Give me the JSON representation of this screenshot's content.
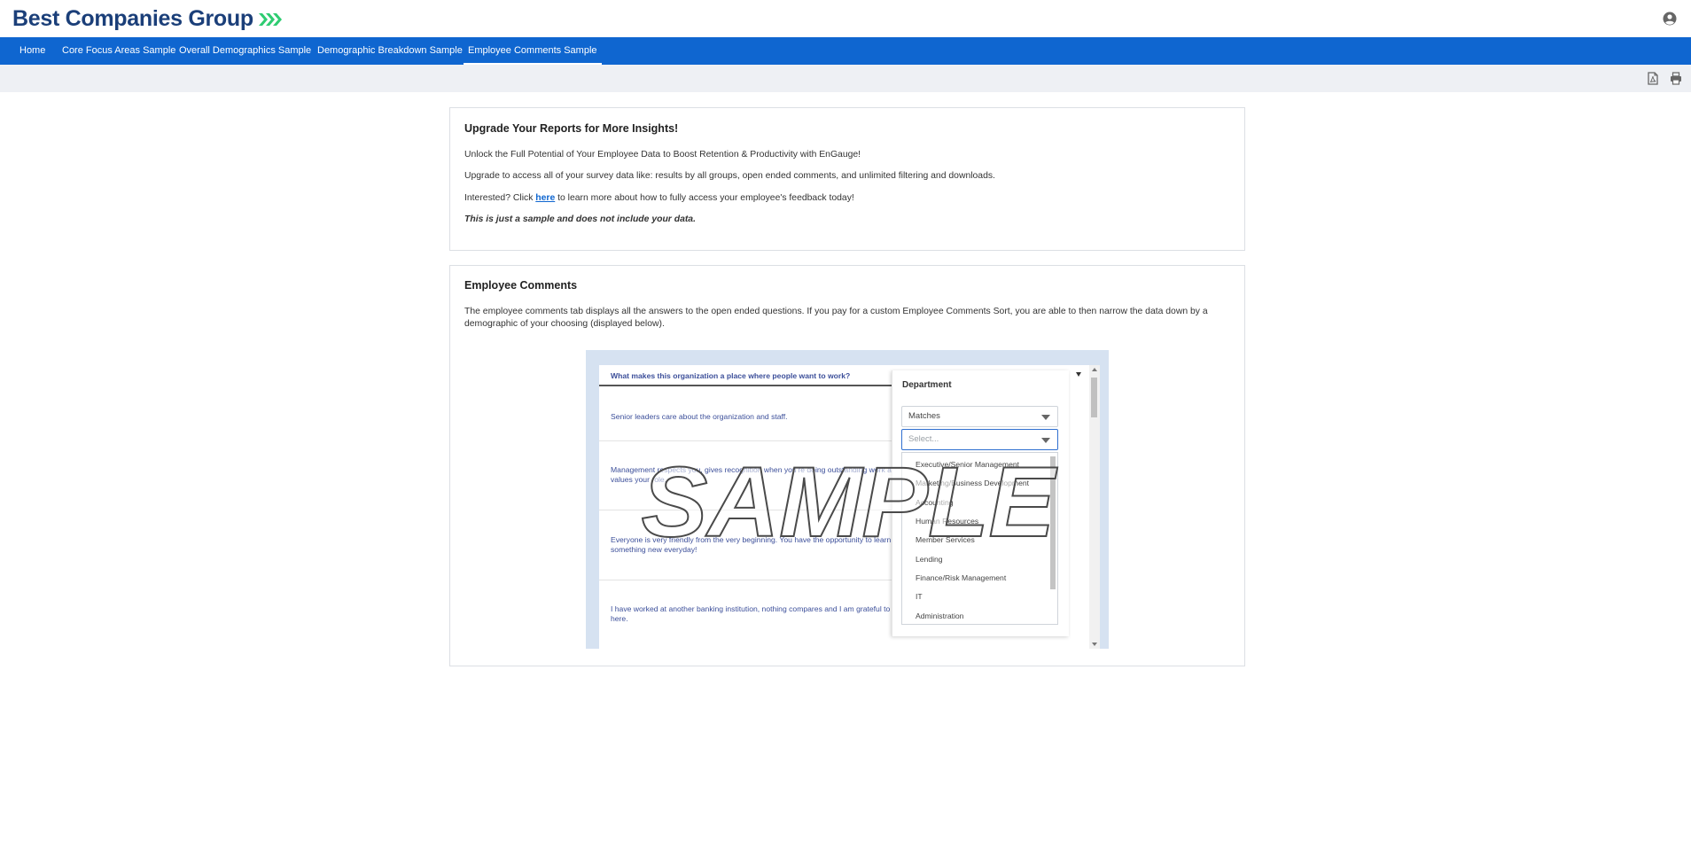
{
  "header": {
    "logo_text": "Best Companies Group",
    "brand_color": "#1b3f79",
    "accent_color": "#2ecc71",
    "user_icon": "user-circle-icon"
  },
  "nav": {
    "color": "#0f66d0",
    "items": [
      {
        "label": "Home"
      },
      {
        "label": "Core Focus Areas Sample"
      },
      {
        "label": "Overall Demographics Sample"
      },
      {
        "label": "Demographic Breakdown Sample"
      },
      {
        "label": "Employee Comments Sample",
        "active": true
      }
    ]
  },
  "toolbar": {
    "pdf_icon": "pdf-export-icon",
    "print_icon": "print-icon"
  },
  "upgrade": {
    "title": "Upgrade Your Reports for More Insights!",
    "line1": "Unlock the Full Potential of Your Employee Data to Boost Retention & Productivity with EnGauge!",
    "line2": "Upgrade to access all of your survey data like: results by all groups, open ended comments, and unlimited filtering and downloads.",
    "line3_before": "Interested? Click ",
    "line3_link": "here",
    "line3_after": " to learn more about how to fully access your employee's feedback today!",
    "line4": "This is just a sample and does not include your data."
  },
  "comments": {
    "title": "Employee Comments",
    "description": "The employee comments tab displays all the answers to the open ended questions. If you pay for a custom Employee Comments Sort, you are able to then narrow the data down by a demographic of your choosing (displayed below)."
  },
  "sample_image": {
    "question_header": "What makes this organization a place where people want to work?",
    "rows": [
      {
        "text": "Senior leaders care about the organization and staff."
      },
      {
        "text": "Management respects you, gives recognition when you're doing outstanding work and values your role."
      },
      {
        "text": "Everyone is very friendly from the very beginning. You have the opportunity to learn something new everyday!"
      },
      {
        "text": "I have worked at another banking institution, nothing compares and I am grateful to be here."
      }
    ],
    "filter": {
      "title": "Department",
      "operator": "Matches",
      "placeholder": "Select...",
      "options": [
        "Executive/Senior Management",
        "Marketing/Business Development",
        "Accounting",
        "Human Resources",
        "Member Services",
        "Lending",
        "Finance/Risk Management",
        "IT",
        "Administration"
      ]
    },
    "watermark": "SAMPLE"
  }
}
